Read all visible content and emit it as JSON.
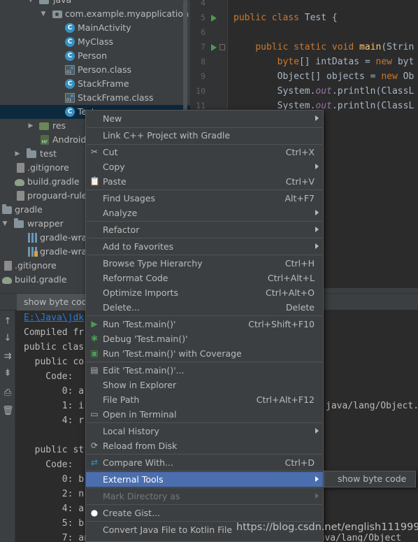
{
  "project_tree": {
    "items": [
      {
        "label": "java",
        "icon": "folder-icon"
      },
      {
        "label": "com.example.myapplication",
        "icon": "package-icon"
      },
      {
        "label": "MainActivity",
        "icon": "class-icon"
      },
      {
        "label": "MyClass",
        "icon": "class-icon"
      },
      {
        "label": "Person",
        "icon": "class-icon"
      },
      {
        "label": "Person.class",
        "icon": "class-file-icon"
      },
      {
        "label": "StackFrame",
        "icon": "class-icon"
      },
      {
        "label": "StackFrame.class",
        "icon": "class-file-icon"
      },
      {
        "label": "Test",
        "icon": "class-icon"
      },
      {
        "label": "res",
        "icon": "resource-folder-icon"
      },
      {
        "label": "Android",
        "icon": "manifest-icon"
      },
      {
        "label": "test",
        "icon": "folder-icon"
      },
      {
        "label": ".gitignore",
        "icon": "file-icon"
      },
      {
        "label": "build.gradle",
        "icon": "gradle-icon"
      },
      {
        "label": "proguard-rules",
        "icon": "file-icon"
      },
      {
        "label": "gradle",
        "icon": "folder-icon"
      },
      {
        "label": "wrapper",
        "icon": "folder-icon"
      },
      {
        "label": "gradle-wra",
        "icon": "jar-icon"
      },
      {
        "label": "gradle-wra",
        "icon": "properties-icon"
      },
      {
        "label": ".gitignore",
        "icon": "file-icon"
      },
      {
        "label": "build.gradle",
        "icon": "gradle-icon"
      }
    ]
  },
  "editor": {
    "lines": [
      {
        "num": "4",
        "text": ""
      },
      {
        "num": "5",
        "text": "public class Test {"
      },
      {
        "num": "6",
        "text": ""
      },
      {
        "num": "7",
        "text": "    public static void main(Strin"
      },
      {
        "num": "8",
        "text": "        byte[] intDatas = new byt"
      },
      {
        "num": "9",
        "text": "        Object[] objects = new Ob"
      },
      {
        "num": "10",
        "text": "        System.out.println(ClassL"
      },
      {
        "num": "11",
        "text": "        System.out.println(ClassL"
      }
    ]
  },
  "run_panel": {
    "tab_label": "show byte code",
    "console": [
      "E:\\Java\\jdk",
      "Compiled fr",
      "public clas",
      "  public co",
      "    Code:",
      "       0: a",
      "       1: i",
      "       4: r",
      "",
      "  public st",
      "    Code:",
      "       0: b",
      "       2: n",
      "       4: a",
      "       5: b",
      "       7: anewarray     #2                  // class java/lang/Object"
    ],
    "console_right_fragment": "java/lang/Object."
  },
  "context_menu": {
    "items": [
      {
        "label": "New",
        "submenu": true
      },
      {
        "label": "Link C++ Project with Gradle"
      },
      {
        "label": "Cut",
        "shortcut": "Ctrl+X",
        "icon": "scissors-icon"
      },
      {
        "label": "Copy",
        "submenu": true
      },
      {
        "label": "Paste",
        "shortcut": "Ctrl+V",
        "icon": "clipboard-icon"
      },
      {
        "label": "Find Usages",
        "shortcut": "Alt+F7"
      },
      {
        "label": "Analyze",
        "submenu": true
      },
      {
        "label": "Refactor",
        "submenu": true
      },
      {
        "label": "Add to Favorites",
        "submenu": true
      },
      {
        "label": "Browse Type Hierarchy",
        "shortcut": "Ctrl+H"
      },
      {
        "label": "Reformat Code",
        "shortcut": "Ctrl+Alt+L"
      },
      {
        "label": "Optimize Imports",
        "shortcut": "Ctrl+Alt+O"
      },
      {
        "label": "Delete...",
        "shortcut": "Delete"
      },
      {
        "label": "Run 'Test.main()'",
        "shortcut": "Ctrl+Shift+F10",
        "icon": "run-icon"
      },
      {
        "label": "Debug 'Test.main()'",
        "icon": "debug-icon"
      },
      {
        "label": "Run 'Test.main()' with Coverage",
        "icon": "coverage-icon"
      },
      {
        "label": "Edit 'Test.main()'...",
        "icon": "edit-config-icon"
      },
      {
        "label": "Show in Explorer"
      },
      {
        "label": "File Path",
        "shortcut": "Ctrl+Alt+F12"
      },
      {
        "label": "Open in Terminal",
        "icon": "terminal-icon"
      },
      {
        "label": "Local History",
        "submenu": true
      },
      {
        "label": "Reload from Disk",
        "icon": "reload-icon"
      },
      {
        "label": "Compare With...",
        "shortcut": "Ctrl+D",
        "icon": "compare-icon"
      },
      {
        "label": "External Tools",
        "submenu": true
      },
      {
        "label": "Mark Directory as",
        "submenu": true
      },
      {
        "label": "Create Gist...",
        "icon": "github-icon"
      },
      {
        "label": "Convert Java File to Kotlin File"
      }
    ]
  },
  "submenu": {
    "label": "show byte code"
  },
  "watermark": "https://blog.csdn.net/english111999",
  "colors": {
    "tree_bg": "#3c3f41",
    "editor_bg": "#2b2b2b",
    "menu_highlight": "#4b6eaf",
    "keyword": "#cc7832",
    "method": "#ffc66d",
    "static_field": "#9876aa",
    "link": "#287bde"
  }
}
